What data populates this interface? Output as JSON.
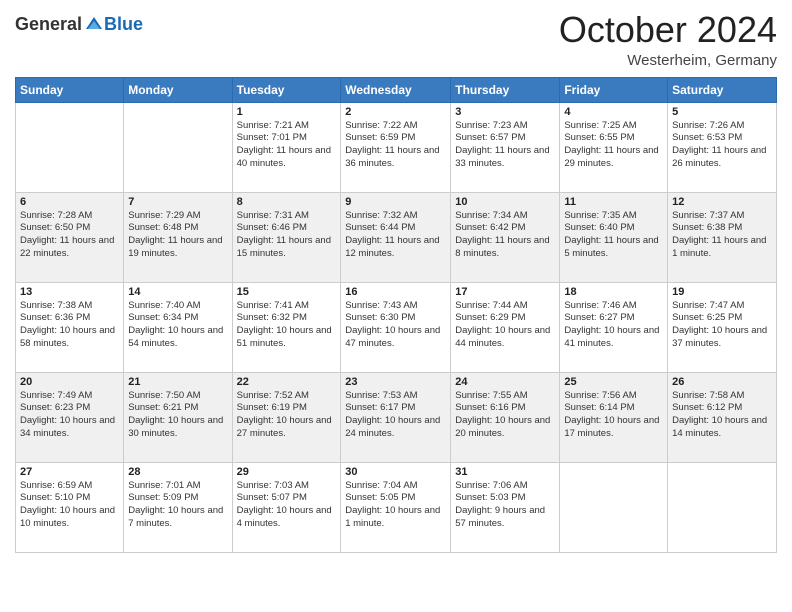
{
  "header": {
    "logo_general": "General",
    "logo_blue": "Blue",
    "month": "October 2024",
    "location": "Westerheim, Germany"
  },
  "days_of_week": [
    "Sunday",
    "Monday",
    "Tuesday",
    "Wednesday",
    "Thursday",
    "Friday",
    "Saturday"
  ],
  "weeks": [
    [
      {
        "day": "",
        "sunrise": "",
        "sunset": "",
        "daylight": ""
      },
      {
        "day": "",
        "sunrise": "",
        "sunset": "",
        "daylight": ""
      },
      {
        "day": "1",
        "sunrise": "Sunrise: 7:21 AM",
        "sunset": "Sunset: 7:01 PM",
        "daylight": "Daylight: 11 hours and 40 minutes."
      },
      {
        "day": "2",
        "sunrise": "Sunrise: 7:22 AM",
        "sunset": "Sunset: 6:59 PM",
        "daylight": "Daylight: 11 hours and 36 minutes."
      },
      {
        "day": "3",
        "sunrise": "Sunrise: 7:23 AM",
        "sunset": "Sunset: 6:57 PM",
        "daylight": "Daylight: 11 hours and 33 minutes."
      },
      {
        "day": "4",
        "sunrise": "Sunrise: 7:25 AM",
        "sunset": "Sunset: 6:55 PM",
        "daylight": "Daylight: 11 hours and 29 minutes."
      },
      {
        "day": "5",
        "sunrise": "Sunrise: 7:26 AM",
        "sunset": "Sunset: 6:53 PM",
        "daylight": "Daylight: 11 hours and 26 minutes."
      }
    ],
    [
      {
        "day": "6",
        "sunrise": "Sunrise: 7:28 AM",
        "sunset": "Sunset: 6:50 PM",
        "daylight": "Daylight: 11 hours and 22 minutes."
      },
      {
        "day": "7",
        "sunrise": "Sunrise: 7:29 AM",
        "sunset": "Sunset: 6:48 PM",
        "daylight": "Daylight: 11 hours and 19 minutes."
      },
      {
        "day": "8",
        "sunrise": "Sunrise: 7:31 AM",
        "sunset": "Sunset: 6:46 PM",
        "daylight": "Daylight: 11 hours and 15 minutes."
      },
      {
        "day": "9",
        "sunrise": "Sunrise: 7:32 AM",
        "sunset": "Sunset: 6:44 PM",
        "daylight": "Daylight: 11 hours and 12 minutes."
      },
      {
        "day": "10",
        "sunrise": "Sunrise: 7:34 AM",
        "sunset": "Sunset: 6:42 PM",
        "daylight": "Daylight: 11 hours and 8 minutes."
      },
      {
        "day": "11",
        "sunrise": "Sunrise: 7:35 AM",
        "sunset": "Sunset: 6:40 PM",
        "daylight": "Daylight: 11 hours and 5 minutes."
      },
      {
        "day": "12",
        "sunrise": "Sunrise: 7:37 AM",
        "sunset": "Sunset: 6:38 PM",
        "daylight": "Daylight: 11 hours and 1 minute."
      }
    ],
    [
      {
        "day": "13",
        "sunrise": "Sunrise: 7:38 AM",
        "sunset": "Sunset: 6:36 PM",
        "daylight": "Daylight: 10 hours and 58 minutes."
      },
      {
        "day": "14",
        "sunrise": "Sunrise: 7:40 AM",
        "sunset": "Sunset: 6:34 PM",
        "daylight": "Daylight: 10 hours and 54 minutes."
      },
      {
        "day": "15",
        "sunrise": "Sunrise: 7:41 AM",
        "sunset": "Sunset: 6:32 PM",
        "daylight": "Daylight: 10 hours and 51 minutes."
      },
      {
        "day": "16",
        "sunrise": "Sunrise: 7:43 AM",
        "sunset": "Sunset: 6:30 PM",
        "daylight": "Daylight: 10 hours and 47 minutes."
      },
      {
        "day": "17",
        "sunrise": "Sunrise: 7:44 AM",
        "sunset": "Sunset: 6:29 PM",
        "daylight": "Daylight: 10 hours and 44 minutes."
      },
      {
        "day": "18",
        "sunrise": "Sunrise: 7:46 AM",
        "sunset": "Sunset: 6:27 PM",
        "daylight": "Daylight: 10 hours and 41 minutes."
      },
      {
        "day": "19",
        "sunrise": "Sunrise: 7:47 AM",
        "sunset": "Sunset: 6:25 PM",
        "daylight": "Daylight: 10 hours and 37 minutes."
      }
    ],
    [
      {
        "day": "20",
        "sunrise": "Sunrise: 7:49 AM",
        "sunset": "Sunset: 6:23 PM",
        "daylight": "Daylight: 10 hours and 34 minutes."
      },
      {
        "day": "21",
        "sunrise": "Sunrise: 7:50 AM",
        "sunset": "Sunset: 6:21 PM",
        "daylight": "Daylight: 10 hours and 30 minutes."
      },
      {
        "day": "22",
        "sunrise": "Sunrise: 7:52 AM",
        "sunset": "Sunset: 6:19 PM",
        "daylight": "Daylight: 10 hours and 27 minutes."
      },
      {
        "day": "23",
        "sunrise": "Sunrise: 7:53 AM",
        "sunset": "Sunset: 6:17 PM",
        "daylight": "Daylight: 10 hours and 24 minutes."
      },
      {
        "day": "24",
        "sunrise": "Sunrise: 7:55 AM",
        "sunset": "Sunset: 6:16 PM",
        "daylight": "Daylight: 10 hours and 20 minutes."
      },
      {
        "day": "25",
        "sunrise": "Sunrise: 7:56 AM",
        "sunset": "Sunset: 6:14 PM",
        "daylight": "Daylight: 10 hours and 17 minutes."
      },
      {
        "day": "26",
        "sunrise": "Sunrise: 7:58 AM",
        "sunset": "Sunset: 6:12 PM",
        "daylight": "Daylight: 10 hours and 14 minutes."
      }
    ],
    [
      {
        "day": "27",
        "sunrise": "Sunrise: 6:59 AM",
        "sunset": "Sunset: 5:10 PM",
        "daylight": "Daylight: 10 hours and 10 minutes."
      },
      {
        "day": "28",
        "sunrise": "Sunrise: 7:01 AM",
        "sunset": "Sunset: 5:09 PM",
        "daylight": "Daylight: 10 hours and 7 minutes."
      },
      {
        "day": "29",
        "sunrise": "Sunrise: 7:03 AM",
        "sunset": "Sunset: 5:07 PM",
        "daylight": "Daylight: 10 hours and 4 minutes."
      },
      {
        "day": "30",
        "sunrise": "Sunrise: 7:04 AM",
        "sunset": "Sunset: 5:05 PM",
        "daylight": "Daylight: 10 hours and 1 minute."
      },
      {
        "day": "31",
        "sunrise": "Sunrise: 7:06 AM",
        "sunset": "Sunset: 5:03 PM",
        "daylight": "Daylight: 9 hours and 57 minutes."
      },
      {
        "day": "",
        "sunrise": "",
        "sunset": "",
        "daylight": ""
      },
      {
        "day": "",
        "sunrise": "",
        "sunset": "",
        "daylight": ""
      }
    ]
  ]
}
